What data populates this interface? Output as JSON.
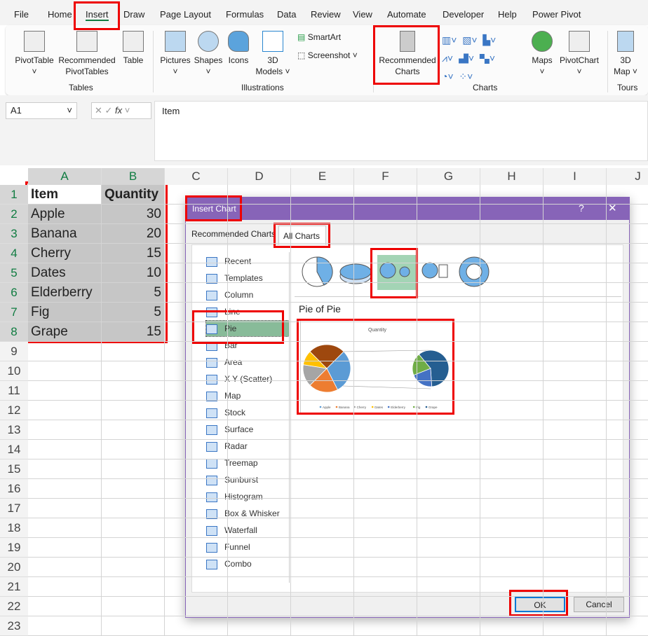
{
  "menu": [
    "File",
    "Home",
    "Insert",
    "Draw",
    "Page Layout",
    "Formulas",
    "Data",
    "Review",
    "View",
    "Automate",
    "Developer",
    "Help",
    "Power Pivot"
  ],
  "ribbon": {
    "tables": {
      "label": "Tables",
      "pivot": "PivotTable",
      "recpivot1": "Recommended",
      "recpivot2": "PivotTables",
      "table": "Table"
    },
    "illustrations": {
      "label": "Illustrations",
      "pictures": "Pictures",
      "shapes": "Shapes",
      "icons": "Icons",
      "models1": "3D",
      "models2": "Models",
      "smartart": "SmartArt",
      "screenshot": "Screenshot"
    },
    "charts": {
      "label": "Charts",
      "rec1": "Recommended",
      "rec2": "Charts",
      "maps": "Maps",
      "pivotchart": "PivotChart"
    },
    "tours": {
      "label": "Tours",
      "map1": "3D",
      "map2": "Map"
    }
  },
  "formula_bar": {
    "name_box": "A1",
    "fx": "fx",
    "value": "Item"
  },
  "columns": [
    "A",
    "B",
    "C",
    "D",
    "E",
    "F",
    "G",
    "H",
    "I",
    "J"
  ],
  "rows": [
    "1",
    "2",
    "3",
    "4",
    "5",
    "6",
    "7",
    "8",
    "9",
    "10",
    "11",
    "12",
    "13",
    "14",
    "15",
    "16",
    "17",
    "18",
    "19",
    "20",
    "21",
    "22",
    "23"
  ],
  "table": {
    "headers": [
      "Item",
      "Quantity"
    ],
    "data": [
      [
        "Apple",
        "30"
      ],
      [
        "Banana",
        "20"
      ],
      [
        "Cherry",
        "15"
      ],
      [
        "Dates",
        "10"
      ],
      [
        "Elderberry",
        "5"
      ],
      [
        "Fig",
        "5"
      ],
      [
        "Grape",
        "15"
      ]
    ]
  },
  "dialog": {
    "title": "Insert Chart",
    "help": "?",
    "close": "✕",
    "tabs": [
      "Recommended Charts",
      "All Charts"
    ],
    "chart_types": [
      "Recent",
      "Templates",
      "Column",
      "Line",
      "Pie",
      "Bar",
      "Area",
      "X Y (Scatter)",
      "Map",
      "Stock",
      "Surface",
      "Radar",
      "Treemap",
      "Sunburst",
      "Histogram",
      "Box & Whisker",
      "Waterfall",
      "Funnel",
      "Combo"
    ],
    "selected_type": "Pie",
    "subtype_title": "Pie of Pie",
    "ok": "OK",
    "cancel": "Cancel"
  },
  "chart_data": {
    "type": "pie",
    "variant": "pie-of-pie",
    "title": "Quantity",
    "categories": [
      "Apple",
      "Banana",
      "Cherry",
      "Dates",
      "Elderberry",
      "Fig",
      "Grape"
    ],
    "values": [
      30,
      20,
      15,
      10,
      5,
      5,
      15
    ],
    "colors": [
      "#5b9bd5",
      "#ed7d31",
      "#a5a5a5",
      "#ffc000",
      "#4472c4",
      "#70ad47",
      "#255e91"
    ],
    "other_color": "#9e480e",
    "legend": "bottom"
  }
}
